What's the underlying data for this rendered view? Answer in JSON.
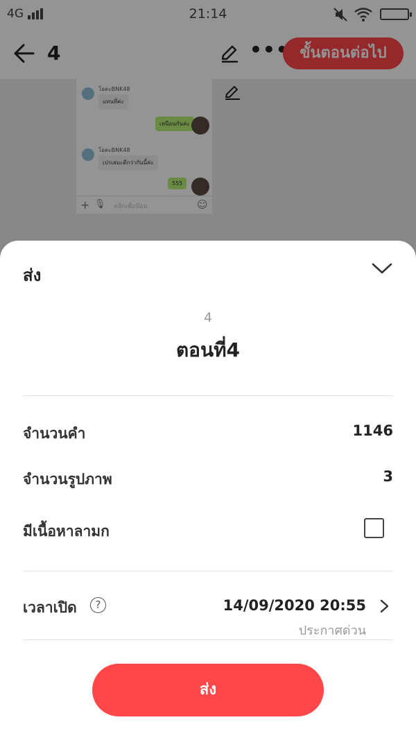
{
  "status_bar": {
    "network": "4G",
    "time": "21:14"
  },
  "header": {
    "chapter_number": "4",
    "next_button_label": "ขั้นตอนต่อไป"
  },
  "preview": {
    "messages": [
      {
        "sender": "โอตะBNK48",
        "text": "แทนที่ค่ะ"
      },
      {
        "reply": "เหนือนกันค่ะ"
      },
      {
        "sender": "โอตะBNK48",
        "text": "เปรเสมะดีกว่ากันนี้ค่ะ"
      },
      {
        "reply": "555"
      }
    ],
    "input_placeholder": "คลิกเพื่อป้อน"
  },
  "sheet": {
    "title": "ส่ง",
    "episode_number": "4",
    "episode_title": "ตอนที่4",
    "word_count_label": "จำนวนคำ",
    "word_count_value": "1146",
    "image_count_label": "จำนวนรูปภาพ",
    "image_count_value": "3",
    "explicit_label": "มีเนื้อหาลามก",
    "explicit_checked": false,
    "publish_time_label": "เวลาเปิด",
    "help_glyph": "?",
    "publish_time_value": "14/09/2020 20:55",
    "publish_time_note": "ประกาศด่วน",
    "submit_label": "ส่ง"
  },
  "colors": {
    "accent": "#ff4649",
    "dim": "rgba(0,0,0,0.42)"
  }
}
